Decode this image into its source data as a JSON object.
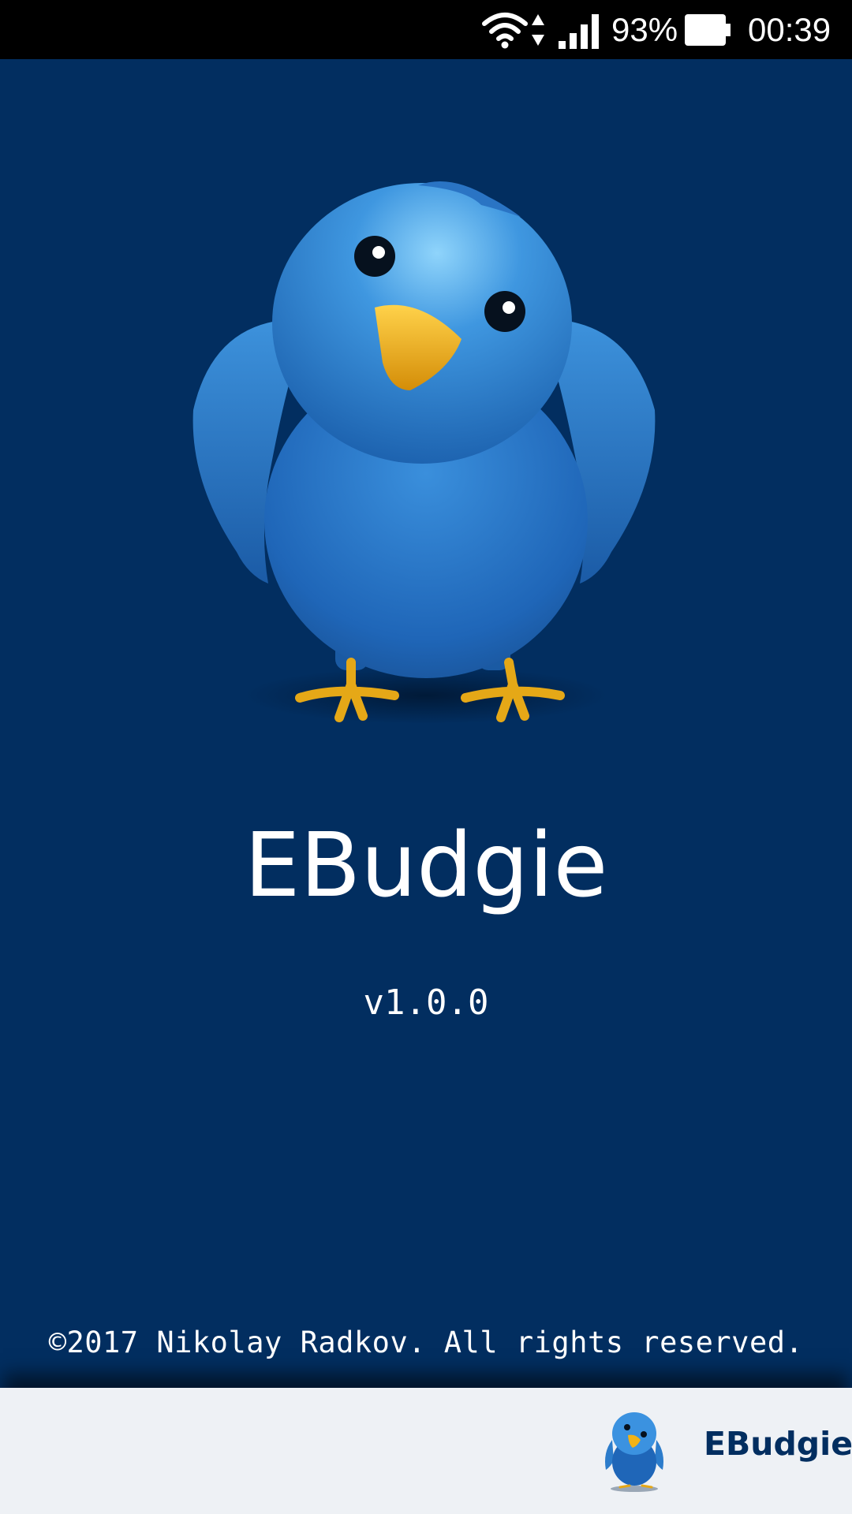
{
  "status_bar": {
    "battery_percent": "93%",
    "time": "00:39",
    "icons": [
      "wifi-icon",
      "data-activity-icon",
      "cell-signal-icon",
      "battery-icon"
    ]
  },
  "splash": {
    "mascot_icon": "budgie-bird-icon",
    "app_name": "EBudgie",
    "version": "v1.0.0",
    "copyright": "©2017 Nikolay Radkov. All rights reserved."
  },
  "bottom_bar": {
    "logo_icon": "budgie-bird-icon",
    "brand_name": "EBudgie"
  },
  "colors": {
    "background": "#022e60",
    "bird_blue": "#2f7fd0",
    "beak": "#f2b316",
    "bottom_bar": "#eef1f5"
  }
}
